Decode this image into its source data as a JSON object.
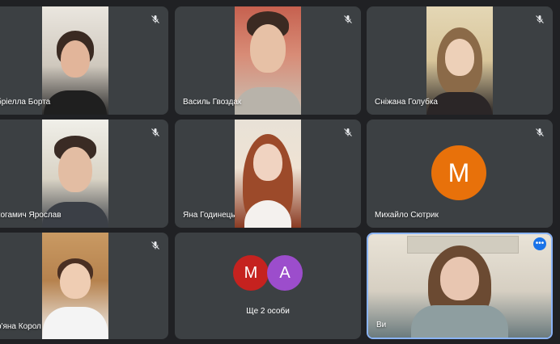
{
  "participants": [
    {
      "name": "бріелла Борта"
    },
    {
      "name": "Василь Гвоздак"
    },
    {
      "name": "Сніжана Голубка"
    },
    {
      "name": "когамич Ярослав"
    },
    {
      "name": "Яна Годинець"
    },
    {
      "name": "Михайло Сютрик",
      "avatar_letter": "M"
    },
    {
      "name": "р'яна Корол"
    },
    {
      "name": "Ще 2 особи",
      "avatar_letters": [
        "M",
        "A"
      ]
    },
    {
      "name": "Ви"
    }
  ],
  "colors": {
    "background": "#202124",
    "tile": "#3c4043",
    "avatar_orange": "#e8710a",
    "avatar_red": "#c5221f",
    "avatar_purple": "#9c4dcc",
    "self_border": "#8ab4f8",
    "more_button": "#1a73e8"
  },
  "icons": {
    "muted": "mic-off-icon",
    "more": "more-options-icon"
  }
}
